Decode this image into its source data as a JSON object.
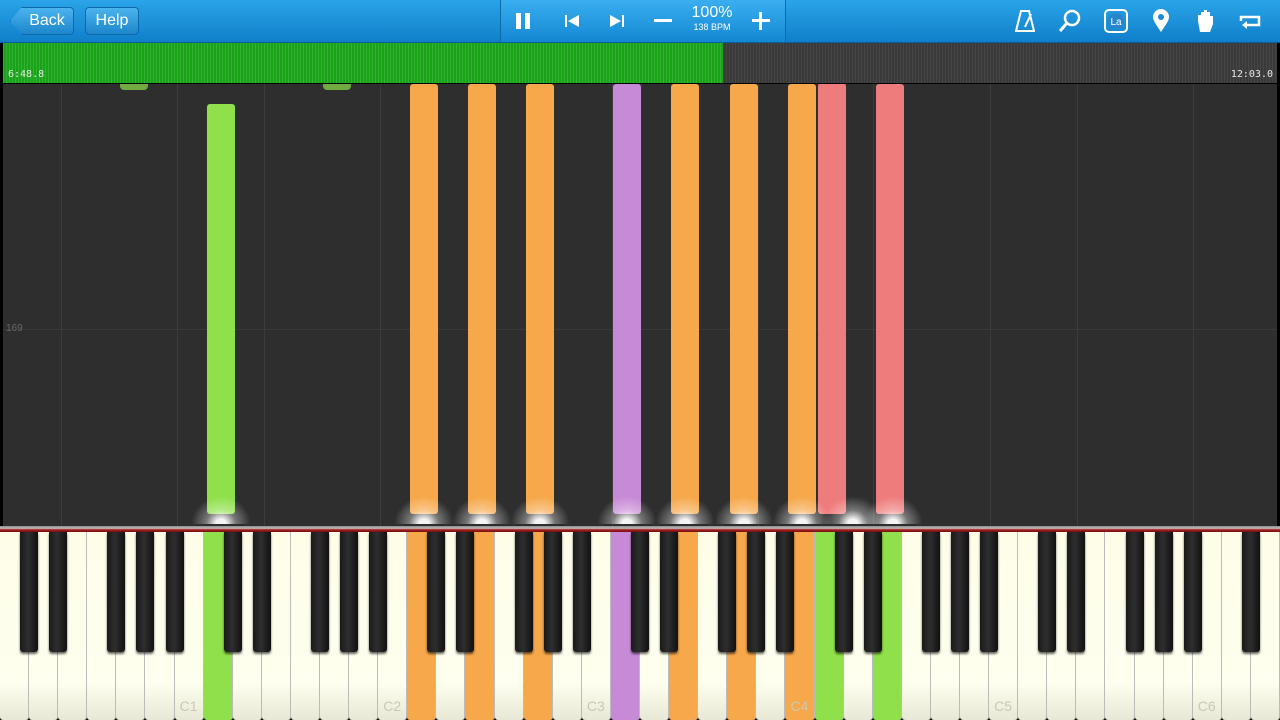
{
  "toolbar": {
    "back_label": "Back",
    "help_label": "Help",
    "speed_percent": "100%",
    "tempo": "138 BPM",
    "icons": [
      "pause-icon",
      "previous-icon",
      "next-icon",
      "minus-icon",
      "plus-icon",
      "metronome-icon",
      "magnifier-icon",
      "note-label-icon",
      "marker-icon",
      "hand-icon",
      "loop-icon"
    ]
  },
  "progress": {
    "elapsed": "6:48.8",
    "total": "12:03.0",
    "fraction": 0.565
  },
  "measure_number": "169",
  "key_labels": [
    "C1",
    "C2",
    "C3",
    "C4",
    "C5",
    "C6"
  ],
  "colors": {
    "orange": "#f6a84a",
    "green": "#8fe04a",
    "purple": "#c78ad6",
    "red": "#ef7c7c",
    "progress_green": "#18a318",
    "toolbar_blue": "#1b92de"
  }
}
